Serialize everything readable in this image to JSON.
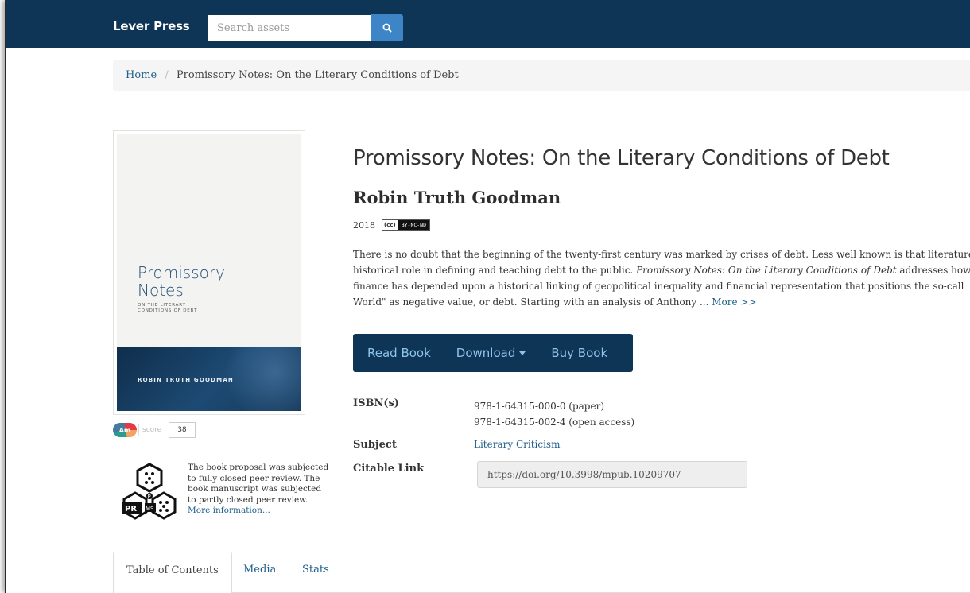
{
  "navbar": {
    "brand": "Lever Press",
    "search_placeholder": "Search assets",
    "search_button_icon": "search-icon",
    "background": "#0e3556"
  },
  "breadcrumb": {
    "home": "Home",
    "separator": "/",
    "current": "Promissory Notes: On the Literary Conditions of Debt"
  },
  "cover": {
    "title_line1": "Promissory",
    "title_line2": "Notes",
    "subtitle_line1": "ON THE LITERARY",
    "subtitle_line2": "CONDITIONS OF DEBT",
    "author": "ROBIN TRUTH GOODMAN"
  },
  "altmetric": {
    "badge": "Am",
    "label": "score",
    "score": "38"
  },
  "peer_review": {
    "icon": "prms-peer-review-icon",
    "text": "The book proposal was subjected to fully closed peer review. The book manuscript was subjected to partly closed peer review.",
    "link": "More information..."
  },
  "book": {
    "title": "Promissory Notes: On the Literary Conditions of Debt",
    "author": "Robin Truth Goodman",
    "year": "2018",
    "license_cc": "(cc)",
    "license": "BY-NC-ND",
    "description": {
      "line1": "There is no doubt that the beginning of the twenty-first century was marked by crises of debt. Less well known is that literature",
      "line2_pre": "historical role in defining and teaching debt to the public. ",
      "line2_italic": "Promissory Notes: On the Literary Conditions of Debt",
      "line2_post": " addresses how r",
      "line3": "finance has depended upon a historical linking of geopolitical inequality and financial representation that positions the so-call",
      "line4": "World\" as negative value, or debt. Starting with an analysis of Anthony ... ",
      "more": "More >>"
    }
  },
  "actions": {
    "read": "Read Book",
    "download": "Download",
    "buy": "Buy Book"
  },
  "metadata": {
    "isbn_label": "ISBN(s)",
    "isbn_paper": "978-1-64315-000-0 (paper)",
    "isbn_oa": "978-1-64315-002-4 (open access)",
    "subject_label": "Subject",
    "subject": "Literary Criticism",
    "citable_label": "Citable Link",
    "citable": "https://doi.org/10.3998/mpub.10209707"
  },
  "tabs": [
    "Table of Contents",
    "Media",
    "Stats"
  ],
  "colors": {
    "link": "#1f5f8b",
    "action_text": "#8fc3ec",
    "search_button": "#3d85c6"
  }
}
